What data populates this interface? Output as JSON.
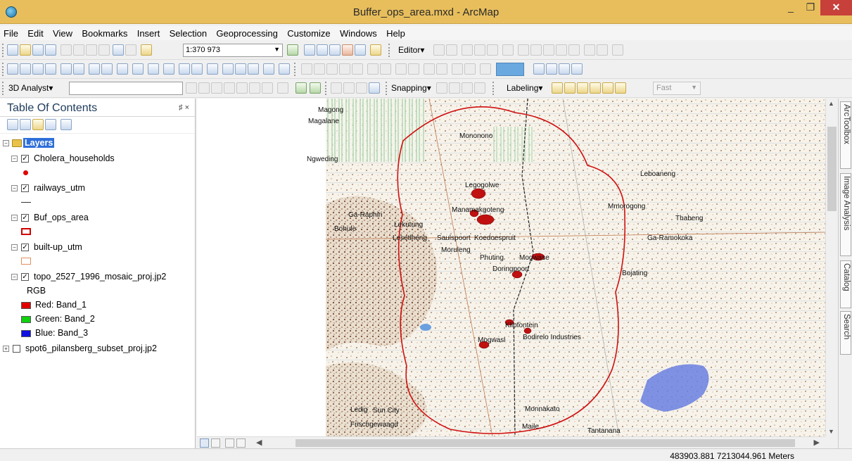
{
  "window": {
    "title": "Buffer_ops_area.mxd - ArcMap",
    "min": "_",
    "max": "❐",
    "close": "✕"
  },
  "menu": [
    "File",
    "Edit",
    "View",
    "Bookmarks",
    "Insert",
    "Selection",
    "Geoprocessing",
    "Customize",
    "Windows",
    "Help"
  ],
  "toolbar": {
    "scale": "1:370 973",
    "editor": "Editor▾",
    "analyst": "3D Analyst▾",
    "snapping": "Snapping▾",
    "labeling": "Labeling▾",
    "fast": "Fast"
  },
  "toc": {
    "title": "Table Of Contents",
    "pin": "♯ ×",
    "root": "Layers",
    "layers": [
      {
        "name": "Cholera_households",
        "checked": true
      },
      {
        "name": "railways_utm",
        "checked": true
      },
      {
        "name": "Buf_ops_area",
        "checked": true
      },
      {
        "name": "built-up_utm",
        "checked": true
      },
      {
        "name": "topo_2527_1996_mosaic_proj.jp2",
        "checked": true
      },
      {
        "name": "spot6_pilansberg_subset_proj.jp2",
        "checked": false
      }
    ],
    "rgb": {
      "label": "RGB",
      "red": "Red:   Band_1",
      "green": "Green: Band_2",
      "blue": "Blue:  Band_3"
    },
    "colors": {
      "red": "#e00000",
      "green": "#10d010",
      "blue": "#1010e0"
    }
  },
  "map": {
    "labels": [
      "Magong",
      "Magalane",
      "Mononono",
      "Ngweding",
      "Leboaneng",
      "Legogolwe",
      "Mmorogong",
      "Thabeng",
      "Manamakgoteng",
      "Ga-Raphiri",
      "Bohule",
      "Lekutung",
      "Lesetlheng",
      "Saulspoort",
      "Koedoespruit",
      "Ga-Ramokoka",
      "Moruleng",
      "Phuting",
      "Mogwase",
      "Doringpoort",
      "Bojating",
      "Klipfontein",
      "Mogwasi",
      "Bodirelo Industries",
      "Ledig",
      "Sun City",
      "Frischgewaagd",
      "Monnakato",
      "Maile",
      "Tantanana"
    ],
    "buffer_color": "#d01010"
  },
  "dock": [
    "ArcToolbox",
    "Image Analysis",
    "Catalog",
    "Search"
  ],
  "status": {
    "coords": "483903.881  7213044.961 Meters"
  }
}
